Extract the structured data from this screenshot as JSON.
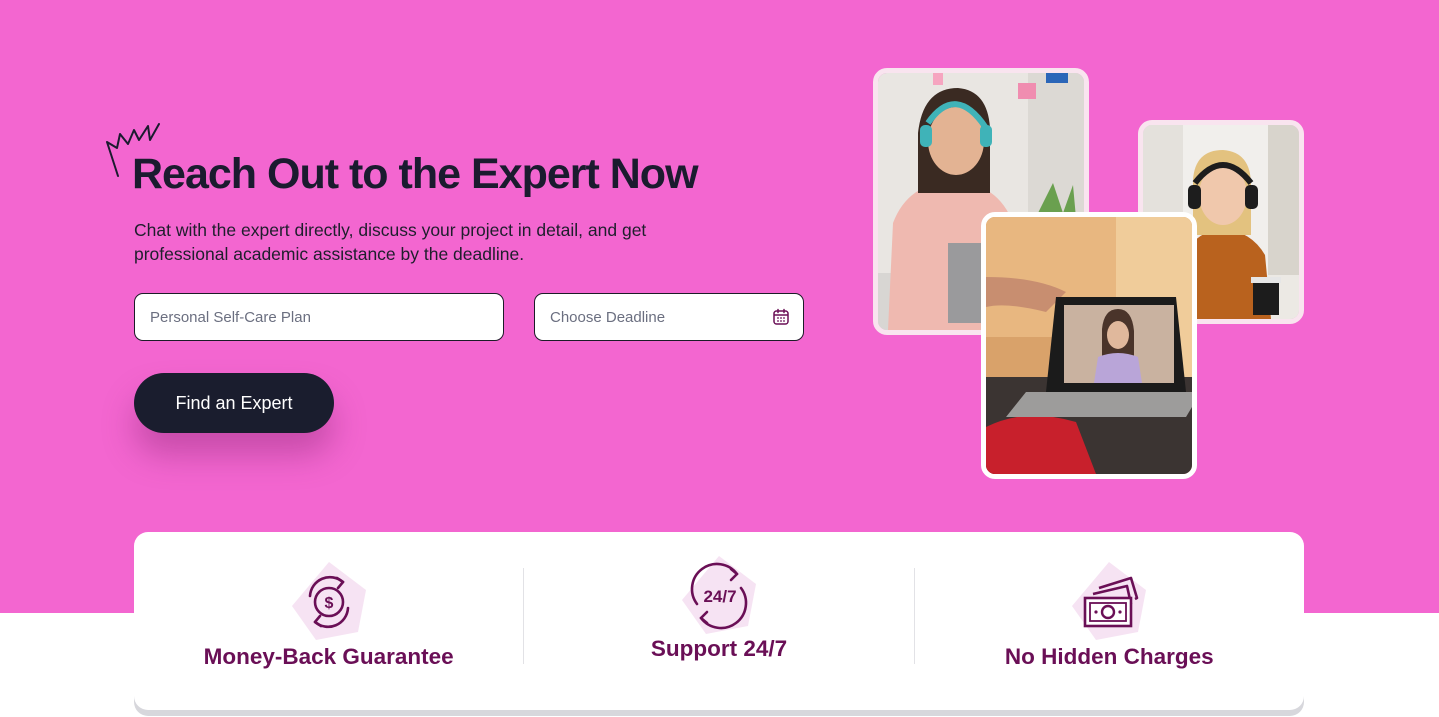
{
  "hero": {
    "title": "Reach Out to the Expert Now",
    "subtitle": "Chat with the expert directly, discuss your project in detail, and get professional academic assistance by the deadline.",
    "topic_placeholder": "Personal Self-Care Plan",
    "deadline_placeholder": "Choose Deadline",
    "cta_label": "Find an Expert"
  },
  "features": [
    {
      "label": "Money-Back Guarantee",
      "icon": "money-back-icon"
    },
    {
      "label": "Support 24/7",
      "icon": "support-24-7-icon",
      "icon_text": "24/7"
    },
    {
      "label": "No Hidden Charges",
      "icon": "banknotes-icon"
    }
  ],
  "colors": {
    "hero_background": "#f366d0",
    "button_background": "#1a1d2e",
    "feature_text": "#6a0f56",
    "title_text": "#1b1b2f"
  }
}
